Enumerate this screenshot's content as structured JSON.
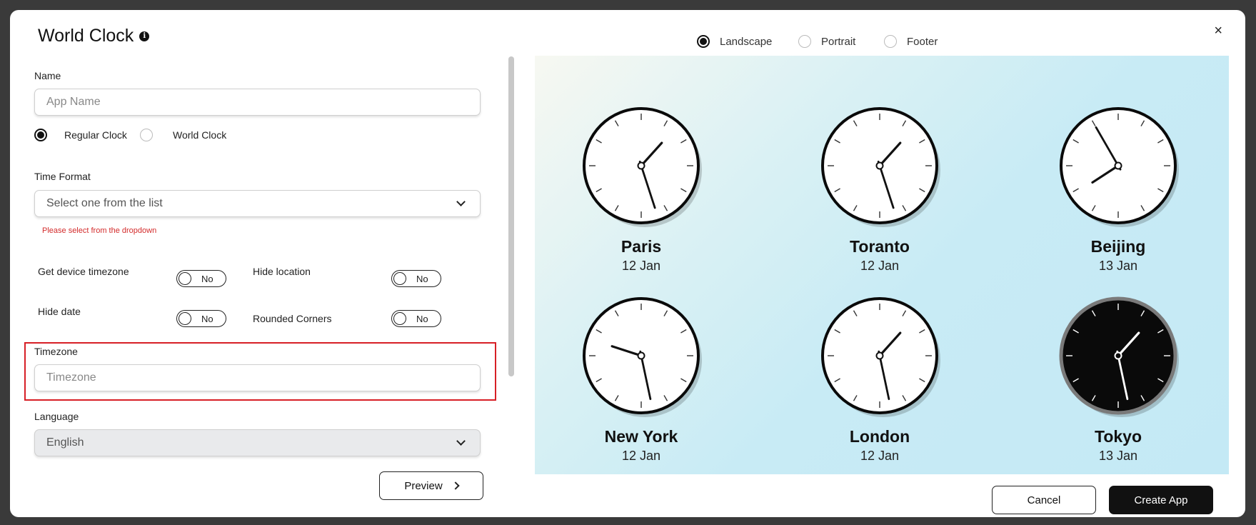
{
  "dialog": {
    "title": "World Clock",
    "close_label": "×",
    "orientation": {
      "options": [
        "Landscape",
        "Portrait",
        "Footer"
      ],
      "selected": "Landscape"
    }
  },
  "form": {
    "name": {
      "label": "Name",
      "placeholder": "App Name",
      "value": ""
    },
    "clock_type": {
      "options": [
        "Regular Clock",
        "World Clock"
      ],
      "selected": "Regular Clock"
    },
    "time_format": {
      "label": "Time Format",
      "value": "Select one from the list",
      "error": "Please select from the dropdown"
    },
    "toggles": {
      "device_timezone": {
        "label": "Get device timezone",
        "value": "No"
      },
      "hide_location": {
        "label": "Hide location",
        "value": "No"
      },
      "hide_date": {
        "label": "Hide date",
        "value": "No"
      },
      "rounded_corners": {
        "label": "Rounded Corners",
        "value": "No"
      }
    },
    "timezone": {
      "label": "Timezone",
      "placeholder": "Timezone",
      "value": ""
    },
    "language": {
      "label": "Language",
      "value": "English"
    }
  },
  "buttons": {
    "preview": "Preview",
    "cancel": "Cancel",
    "create": "Create App"
  },
  "clocks": [
    {
      "city": "Paris",
      "date": "12 Jan",
      "hour": 1.4,
      "minute": 27,
      "theme": "light"
    },
    {
      "city": "Toranto",
      "date": "12 Jan",
      "hour": 1.4,
      "minute": 27,
      "theme": "light"
    },
    {
      "city": "Beijing",
      "date": "13 Jan",
      "hour": 7.9,
      "minute": 55,
      "theme": "light"
    },
    {
      "city": "New York",
      "date": "12 Jan",
      "hour": 9.6,
      "minute": 28,
      "theme": "light"
    },
    {
      "city": "London",
      "date": "12 Jan",
      "hour": 1.4,
      "minute": 28,
      "theme": "light"
    },
    {
      "city": "Tokyo",
      "date": "13 Jan",
      "hour": 1.4,
      "minute": 28,
      "theme": "dark"
    }
  ],
  "colors": {
    "accent_dark": "#111111",
    "error": "#d32b2b",
    "highlight": "#d71f26"
  }
}
